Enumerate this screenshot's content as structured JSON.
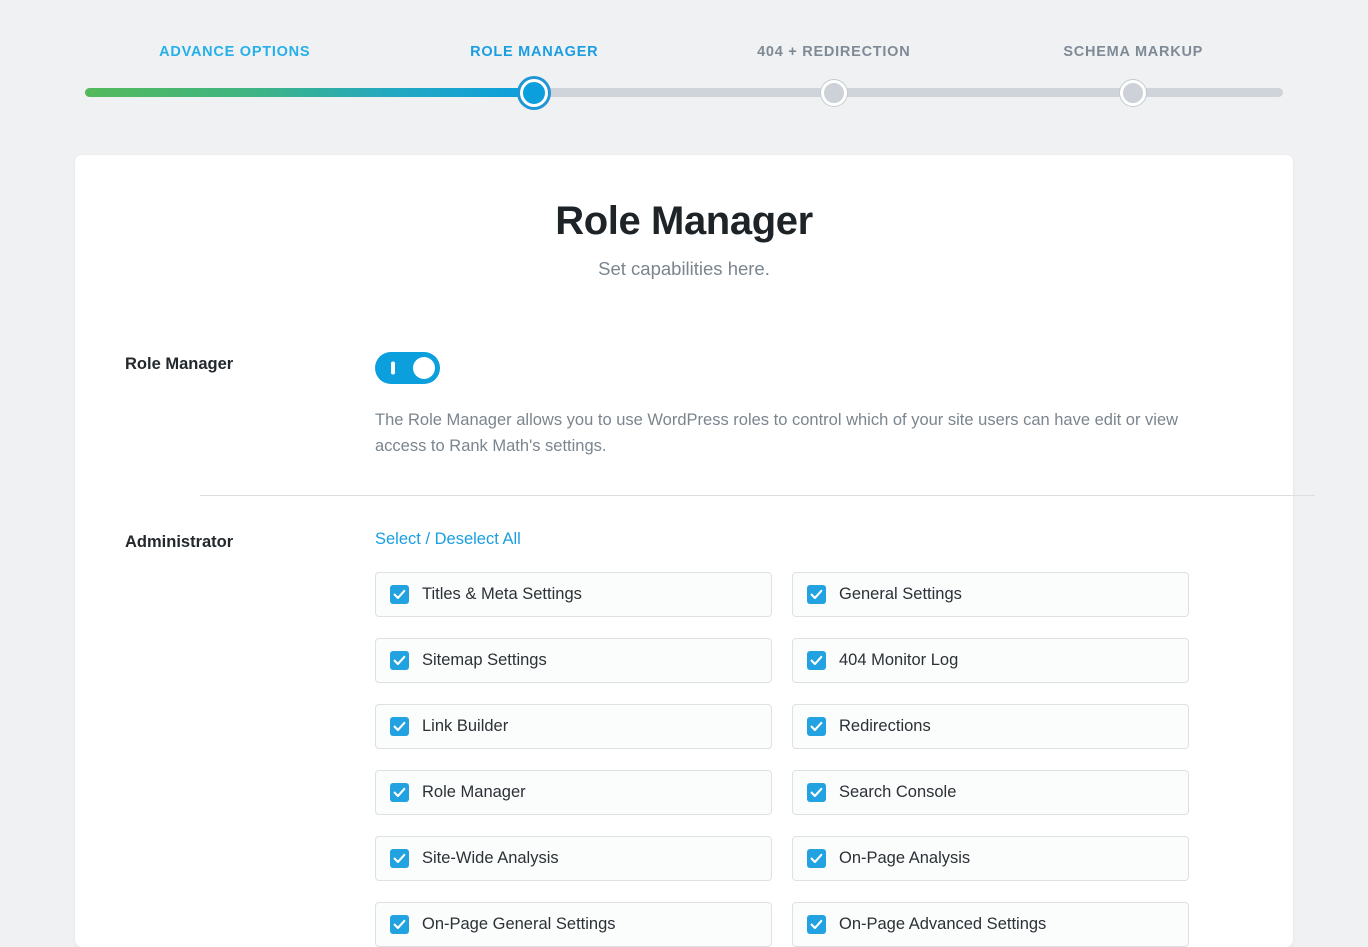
{
  "wizard": {
    "steps": [
      {
        "label": "Advance Options",
        "state": "done"
      },
      {
        "label": "Role Manager",
        "state": "active"
      },
      {
        "label": "404 + Redirection",
        "state": "todo"
      },
      {
        "label": "Schema Markup",
        "state": "todo"
      }
    ],
    "progress_percent": 37,
    "colors": {
      "fill_start": "#53b95a",
      "fill_end": "#0c9fdd",
      "track": "#ced4da",
      "active_dot": "#0c9fdd",
      "inactive_dot": "#ccd2d8"
    }
  },
  "header": {
    "title": "Role Manager",
    "subtitle": "Set capabilities here."
  },
  "role_manager_field": {
    "label": "Role Manager",
    "toggle_on": true,
    "description": "The Role Manager allows you to use WordPress roles to control which of your site users can have edit or view access to Rank Math's settings."
  },
  "administrator": {
    "label": "Administrator",
    "select_deselect_all": "Select / Deselect All",
    "capabilities": [
      {
        "label": "Titles & Meta Settings",
        "checked": true
      },
      {
        "label": "General Settings",
        "checked": true
      },
      {
        "label": "Sitemap Settings",
        "checked": true
      },
      {
        "label": "404 Monitor Log",
        "checked": true
      },
      {
        "label": "Link Builder",
        "checked": true
      },
      {
        "label": "Redirections",
        "checked": true
      },
      {
        "label": "Role Manager",
        "checked": true
      },
      {
        "label": "Search Console",
        "checked": true
      },
      {
        "label": "Site-Wide Analysis",
        "checked": true
      },
      {
        "label": "On-Page Analysis",
        "checked": true
      },
      {
        "label": "On-Page General Settings",
        "checked": true
      },
      {
        "label": "On-Page Advanced Settings",
        "checked": true
      }
    ]
  },
  "theme": {
    "accent": "#0c9fdd",
    "link": "#1a9ee0",
    "page_bg": "#f0f1f2",
    "card_bg": "#ffffff",
    "muted_text": "#7b858e"
  }
}
